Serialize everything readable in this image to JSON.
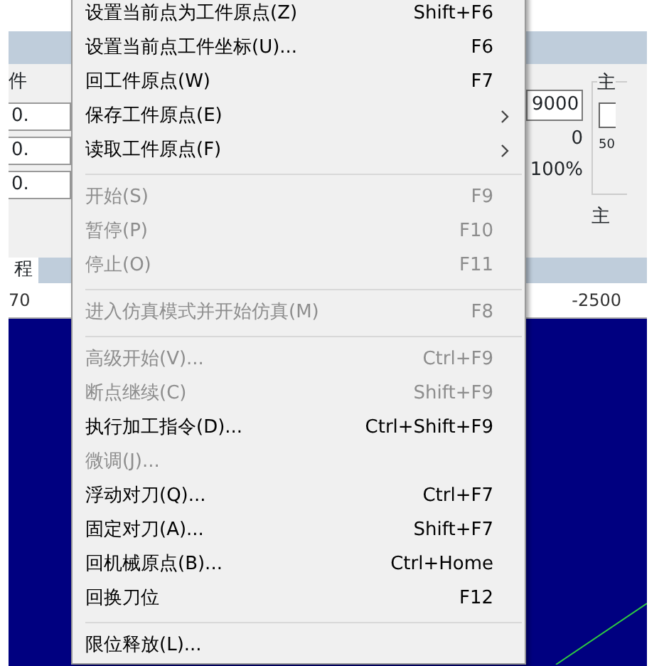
{
  "background": {
    "left_labels": [
      "件",
      "0.",
      "0.",
      "0."
    ],
    "value_field": "9000",
    "readings": [
      "0",
      "100%"
    ],
    "group_label": "主",
    "group_checkbox_checked": false,
    "group_scale": "50",
    "right_label": "主",
    "tab_label": "程",
    "ruler_labels": [
      "70",
      "-2500"
    ]
  },
  "menu": {
    "items": [
      {
        "kind": "item",
        "label": "设置当前点为工件原点(Z)",
        "shortcut": "Shift+F6",
        "disabled": false,
        "submenu": false
      },
      {
        "kind": "item",
        "label": "设置当前点工件坐标(U)...",
        "shortcut": "F6",
        "disabled": false,
        "submenu": false
      },
      {
        "kind": "item",
        "label": "回工件原点(W)",
        "shortcut": "F7",
        "disabled": false,
        "submenu": false
      },
      {
        "kind": "item",
        "label": "保存工件原点(E)",
        "disabled": false,
        "submenu": true
      },
      {
        "kind": "item",
        "label": "读取工件原点(F)",
        "disabled": false,
        "submenu": true
      },
      {
        "kind": "separator"
      },
      {
        "kind": "item",
        "label": "开始(S)",
        "shortcut": "F9",
        "disabled": true,
        "submenu": false
      },
      {
        "kind": "item",
        "label": "暂停(P)",
        "shortcut": "F10",
        "disabled": true,
        "submenu": false
      },
      {
        "kind": "item",
        "label": "停止(O)",
        "shortcut": "F11",
        "disabled": true,
        "submenu": false
      },
      {
        "kind": "separator"
      },
      {
        "kind": "item",
        "label": "进入仿真模式并开始仿真(M)",
        "shortcut": "F8",
        "disabled": true,
        "submenu": false
      },
      {
        "kind": "separator"
      },
      {
        "kind": "item",
        "label": "高级开始(V)...",
        "shortcut": "Ctrl+F9",
        "disabled": true,
        "submenu": false
      },
      {
        "kind": "item",
        "label": "断点继续(C)",
        "shortcut": "Shift+F9",
        "disabled": true,
        "submenu": false
      },
      {
        "kind": "item",
        "label": "执行加工指令(D)...",
        "shortcut": "Ctrl+Shift+F9",
        "disabled": false,
        "submenu": false
      },
      {
        "kind": "item",
        "label": "微调(J)...",
        "disabled": true,
        "submenu": false
      },
      {
        "kind": "item",
        "label": "浮动对刀(Q)...",
        "shortcut": "Ctrl+F7",
        "disabled": false,
        "submenu": false
      },
      {
        "kind": "item",
        "label": "固定对刀(A)...",
        "shortcut": "Shift+F7",
        "disabled": false,
        "submenu": false
      },
      {
        "kind": "item",
        "label": "回机械原点(B)...",
        "shortcut": "Ctrl+Home",
        "disabled": false,
        "submenu": false
      },
      {
        "kind": "item",
        "label": "回换刀位",
        "shortcut": "F12",
        "disabled": false,
        "submenu": false
      },
      {
        "kind": "separator"
      },
      {
        "kind": "item",
        "label": "限位释放(L)...",
        "disabled": false,
        "submenu": false
      }
    ]
  }
}
